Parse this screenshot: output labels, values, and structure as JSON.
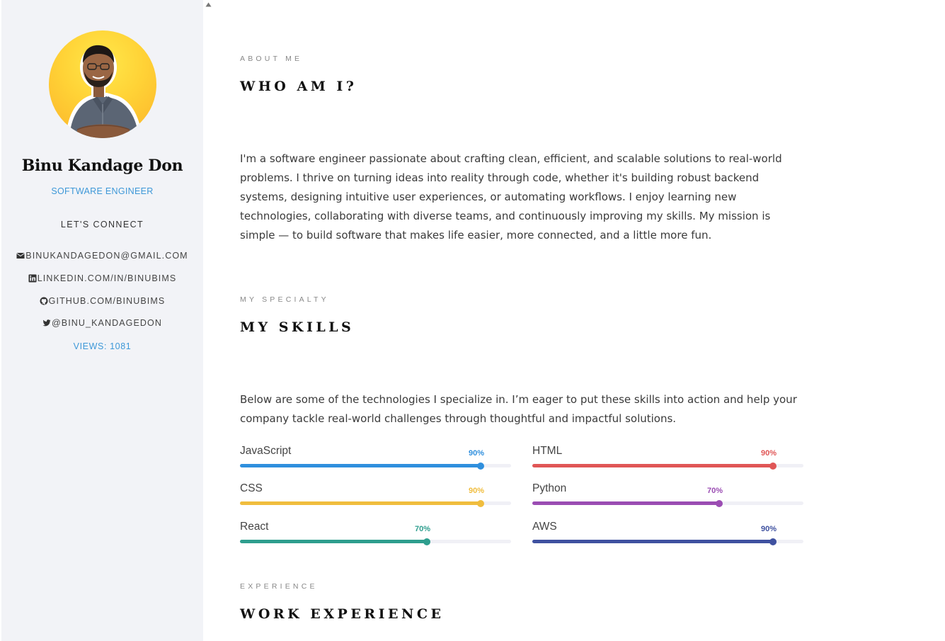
{
  "profile": {
    "name": "Binu Kandage Don",
    "role": "SOFTWARE ENGINEER",
    "connect_label": "LET'S CONNECT",
    "contacts": [
      {
        "icon": "envelope-icon",
        "text": "BINUKANDAGEDON@GMAIL.COM"
      },
      {
        "icon": "linkedin-icon",
        "text": "LINKEDIN.COM/IN/BINUBIMS"
      },
      {
        "icon": "github-icon",
        "text": "GITHUB.COM/BINUBIMS"
      },
      {
        "icon": "twitter-icon",
        "text": "@BINU_KANDAGEDON"
      }
    ],
    "views": "VIEWS: 1081"
  },
  "about": {
    "kicker": "ABOUT ME",
    "heading": "WHO AM I?",
    "text": "I'm a software engineer passionate about crafting clean, efficient, and scalable solutions to real-world problems. I thrive on turning ideas into reality through code, whether it's building robust backend systems, designing intuitive user experiences, or automating workflows. I enjoy learning new technologies, collaborating with diverse teams, and continuously improving my skills. My mission is simple — to build software that makes life easier, more connected, and a little more fun."
  },
  "skills": {
    "kicker": "MY SPECIALTY",
    "heading": "MY SKILLS",
    "text": "Below are some of the technologies I specialize in. I’m eager to put these skills into action and help your company tackle real-world challenges through thoughtful and impactful solutions.",
    "items": [
      {
        "name": "JavaScript",
        "level": 90,
        "label": "90%",
        "color": "#2f8fdd"
      },
      {
        "name": "HTML",
        "level": 90,
        "label": "90%",
        "color": "#e05656"
      },
      {
        "name": "CSS",
        "level": 90,
        "label": "90%",
        "color": "#f0bd3e"
      },
      {
        "name": "Python",
        "level": 70,
        "label": "70%",
        "color": "#9b4db3"
      },
      {
        "name": "React",
        "level": 70,
        "label": "70%",
        "color": "#2e9e8e"
      },
      {
        "name": "AWS",
        "level": 90,
        "label": "90%",
        "color": "#3f51a0"
      }
    ]
  },
  "experience": {
    "kicker": "EXPERIENCE",
    "heading": "WORK EXPERIENCE"
  },
  "colors": {
    "accent": "#3e98d8",
    "sidebar_bg": "#f2f3f7"
  }
}
